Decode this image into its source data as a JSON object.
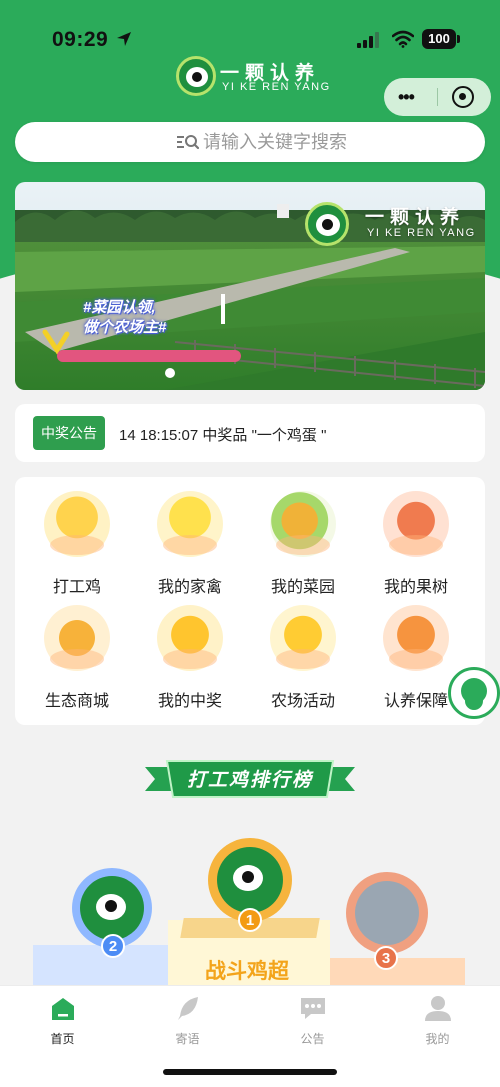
{
  "status_bar": {
    "time": "09:29",
    "battery": "100"
  },
  "logo": {
    "cn": "一颗认养",
    "en": "YI KE REN YANG"
  },
  "search": {
    "placeholder": "请输入关键字搜索"
  },
  "banner": {
    "logo_cn": "一颗认养",
    "logo_en": "YI KE REN YANG",
    "slogan_line1": "#菜园认领,",
    "slogan_line2": "做个农场主#"
  },
  "notice": {
    "tag": "中奖公告",
    "message": "14 18:15:07 中奖品 \"一个鸡蛋 \""
  },
  "menu": {
    "items": [
      {
        "label": "打工鸡",
        "icon": "chick-worker-icon"
      },
      {
        "label": "我的家禽",
        "icon": "chick-icon"
      },
      {
        "label": "我的菜园",
        "icon": "vegetable-icon"
      },
      {
        "label": "我的果树",
        "icon": "fruit-basket-icon"
      },
      {
        "label": "生态商城",
        "icon": "shopping-bag-icon"
      },
      {
        "label": "我的中奖",
        "icon": "golden-egg-icon"
      },
      {
        "label": "农场活动",
        "icon": "coin-star-icon"
      },
      {
        "label": "认养保障",
        "icon": "shield-check-icon"
      }
    ]
  },
  "ranking": {
    "title": "打工鸡排行榜",
    "first_name": "战斗鸡超",
    "ranks": [
      "1",
      "2",
      "3"
    ]
  },
  "tabbar": {
    "items": [
      {
        "label": "首页",
        "icon": "home-icon"
      },
      {
        "label": "寄语",
        "icon": "feather-icon"
      },
      {
        "label": "公告",
        "icon": "message-icon"
      },
      {
        "label": "我的",
        "icon": "user-icon"
      }
    ]
  },
  "colors": {
    "brand": "#2bab5a",
    "notice_tag": "#2f9e4e",
    "rank_gold": "#f3a41b"
  }
}
